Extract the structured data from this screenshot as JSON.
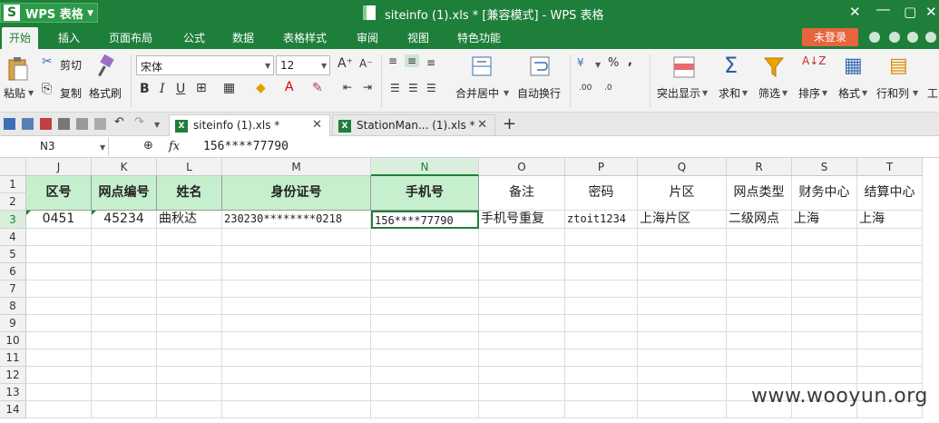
{
  "app": {
    "badge": "WPS 表格",
    "title": "siteinfo (1).xls * [兼容模式] - WPS 表格",
    "login": "未登录"
  },
  "menu": [
    "开始",
    "插入",
    "页面布局",
    "公式",
    "数据",
    "表格样式",
    "审阅",
    "视图",
    "特色功能"
  ],
  "ribbon": {
    "paste": "粘贴",
    "cut": "剪切",
    "copy": "复制",
    "format_painter": "格式刷",
    "font_name": "宋体",
    "font_size": "12",
    "merge_center": "合并居中",
    "wrap_text": "自动换行",
    "highlight": "突出显示",
    "sum": "求和",
    "filter": "筛选",
    "sort": "排序",
    "format": "格式",
    "rows_cols": "行和列",
    "work": "工",
    "percent": "%",
    "comma": ","
  },
  "tabs": [
    {
      "label": "siteinfo (1).xls *",
      "active": true
    },
    {
      "label": "StationMan... (1).xls *",
      "active": false
    }
  ],
  "formula_bar": {
    "name_box": "N3",
    "fx": "fx",
    "value": "156****77790"
  },
  "columns": [
    "J",
    "K",
    "L",
    "M",
    "N",
    "O",
    "P",
    "Q",
    "R",
    "S",
    "T"
  ],
  "rows": [
    "1",
    "2",
    "3",
    "4",
    "5",
    "6",
    "7",
    "8",
    "9",
    "10",
    "11",
    "12",
    "13",
    "14"
  ],
  "header_row": [
    "区号",
    "网点编号",
    "姓名",
    "身份证号",
    "手机号",
    "备注",
    "密码",
    "片区",
    "网点类型",
    "财务中心",
    "结算中心"
  ],
  "data_row": [
    "0451",
    "45234",
    "曲秋达",
    "230230********0218",
    "156****77790",
    "手机号重复",
    "ztoit1234",
    "上海片区",
    "二级网点",
    "上海",
    "上海"
  ],
  "active_cell": "N3",
  "watermark": "www.wooyun.org",
  "colors": {
    "brand": "#1e7f3b",
    "header_fill": "#c6efce",
    "login": "#e8643c"
  }
}
